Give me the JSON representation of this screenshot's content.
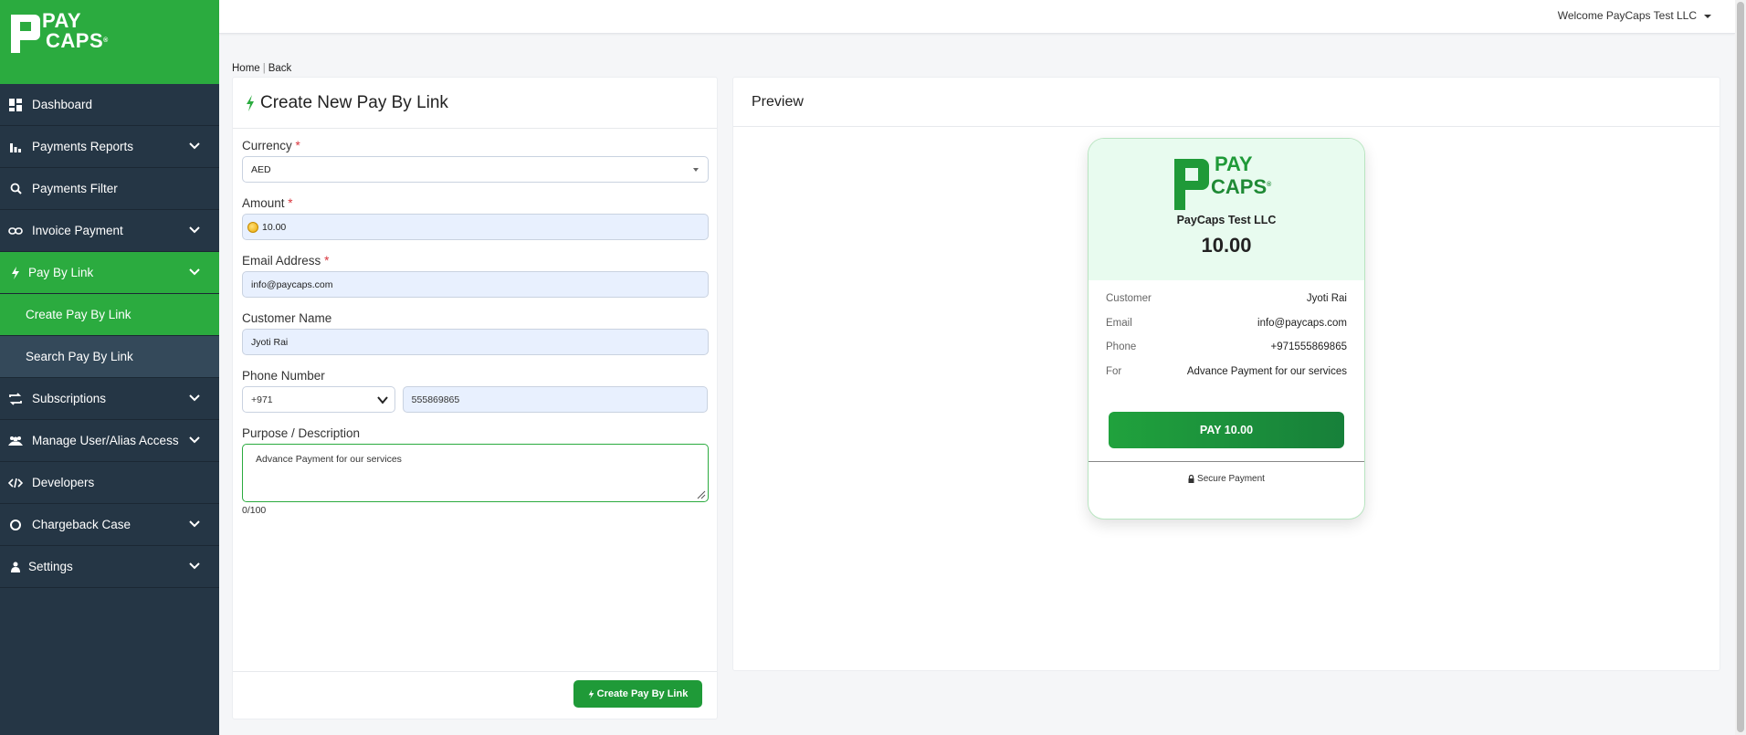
{
  "brand": {
    "line1": "PAY",
    "line2": "CAPS",
    "mark": "®"
  },
  "colors": {
    "brand_green": "#2bab3f",
    "sidebar_bg": "#253645",
    "field_bg": "#e8f0fe"
  },
  "topbar": {
    "welcome": "Welcome PayCaps Test LLC"
  },
  "sidebar": {
    "items": [
      {
        "label": "Dashboard",
        "icon": "dashboard-icon"
      },
      {
        "label": "Payments Reports",
        "icon": "bar-chart-icon"
      },
      {
        "label": "Payments Filter",
        "icon": "search-icon"
      },
      {
        "label": "Invoice Payment",
        "icon": "link-icon"
      },
      {
        "label": "Pay By Link",
        "icon": "bolt-icon"
      },
      {
        "label": "Subscriptions",
        "icon": "repeat-icon"
      },
      {
        "label": "Manage User/Alias Access",
        "icon": "users-icon"
      },
      {
        "label": "Developers",
        "icon": "code-icon"
      },
      {
        "label": "Chargeback Case",
        "icon": "circle-icon"
      },
      {
        "label": "Settings",
        "icon": "user-icon"
      }
    ],
    "sub": {
      "create": "Create Pay By Link",
      "search": "Search Pay By Link"
    }
  },
  "breadcrumb": {
    "home": "Home",
    "sep": "|",
    "back": "Back"
  },
  "form": {
    "title": "Create New Pay By Link",
    "currency_label": "Currency",
    "currency_value": "AED",
    "amount_label": "Amount",
    "amount_value": "10.00",
    "email_label": "Email Address",
    "email_value": "info@paycaps.com",
    "name_label": "Customer Name",
    "name_value": "Jyoti Rai",
    "phone_label": "Phone Number",
    "phone_code": "+971",
    "phone_value": "555869865",
    "purpose_label": "Purpose / Description",
    "purpose_value": "Advance Payment for our services",
    "counter": "0/100",
    "required_mark": "*",
    "submit_label": "Create Pay By Link"
  },
  "preview": {
    "title": "Preview",
    "merchant": "PayCaps Test LLC",
    "amount": "10.00",
    "rows": [
      {
        "k": "Customer",
        "v": "Jyoti Rai"
      },
      {
        "k": "Email",
        "v": "info@paycaps.com"
      },
      {
        "k": "Phone",
        "v": "+971555869865"
      },
      {
        "k": "For",
        "v": "Advance Payment for our services"
      }
    ],
    "pay_button": "PAY 10.00",
    "secure": "Secure Payment"
  }
}
